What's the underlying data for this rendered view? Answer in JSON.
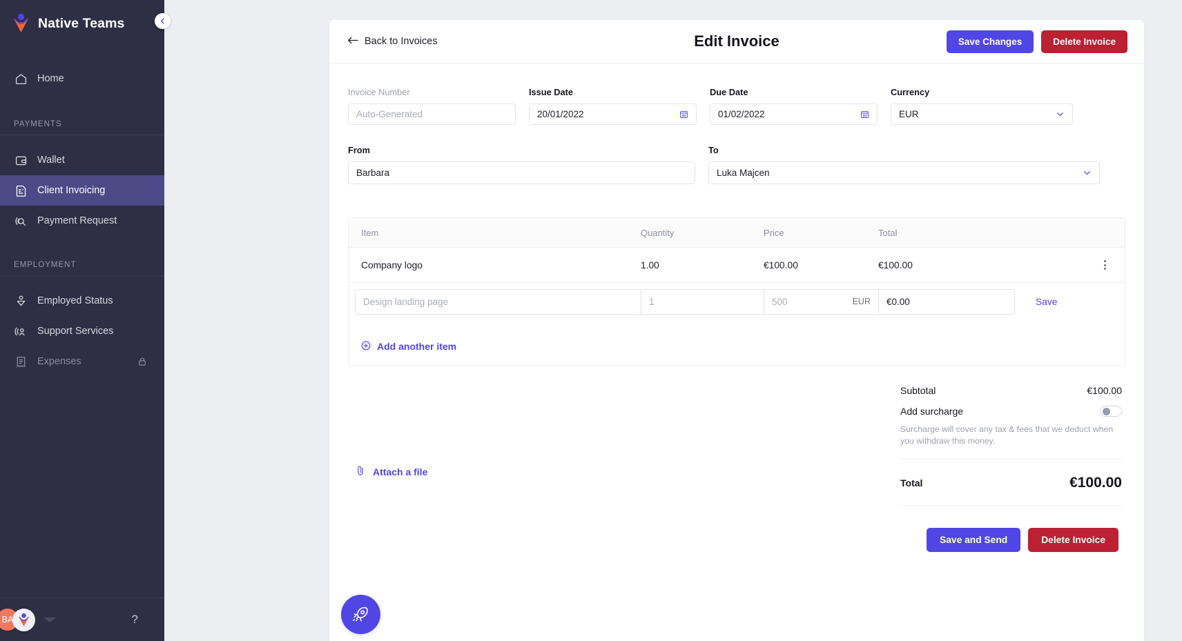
{
  "sidebar": {
    "brand": "Native Teams",
    "collapse_icon": "chevron-left-icon",
    "items_top": [
      {
        "label": "Home",
        "icon": "home-icon",
        "active": false,
        "locked": false
      }
    ],
    "sections": [
      {
        "title": "PAYMENTS",
        "items": [
          {
            "label": "Wallet",
            "icon": "wallet-icon",
            "active": false,
            "locked": false
          },
          {
            "label": "Client Invoicing",
            "icon": "invoice-icon",
            "active": true,
            "locked": false
          },
          {
            "label": "Payment Request",
            "icon": "payment-request-icon",
            "active": false,
            "locked": false
          }
        ]
      },
      {
        "title": "EMPLOYMENT",
        "items": [
          {
            "label": "Employed Status",
            "icon": "employed-status-icon",
            "active": false,
            "locked": false
          },
          {
            "label": "Support Services",
            "icon": "support-services-icon",
            "active": false,
            "locked": false
          },
          {
            "label": "Expenses",
            "icon": "expenses-icon",
            "active": false,
            "locked": true
          }
        ]
      }
    ],
    "footer": {
      "avatar_initials": "BA",
      "help_label": "?"
    },
    "fab_icon": "rocket-icon"
  },
  "header": {
    "back_label": "Back to Invoices",
    "back_icon": "arrow-left-icon",
    "title": "Edit Invoice",
    "save_changes_label": "Save Changes",
    "delete_invoice_label": "Delete Invoice"
  },
  "form": {
    "invoice_number": {
      "label": "Invoice Number",
      "value": "",
      "placeholder": "Auto-Generated"
    },
    "issue_date": {
      "label": "Issue Date",
      "value": "20/01/2022",
      "icon": "calendar-icon"
    },
    "due_date": {
      "label": "Due Date",
      "value": "01/02/2022",
      "icon": "calendar-icon"
    },
    "currency": {
      "label": "Currency",
      "value": "EUR",
      "icon": "chevron-down-icon"
    },
    "from": {
      "label": "From",
      "value": "Barbara"
    },
    "to": {
      "label": "To",
      "value": "Luka Majcen",
      "icon": "chevron-down-icon"
    }
  },
  "items_table": {
    "columns": [
      "Item",
      "Quantity",
      "Price",
      "Total"
    ],
    "rows": [
      {
        "item": "Company logo",
        "quantity": "1.00",
        "price": "€100.00",
        "total": "€100.00",
        "menu_icon": "kebab-menu-icon"
      }
    ],
    "edit_row": {
      "item_placeholder": "Design landing page",
      "quantity_placeholder": "1",
      "price_placeholder": "500",
      "price_currency": "EUR",
      "total_value": "€0.00",
      "save_label": "Save"
    },
    "add_item_label": "Add another item",
    "add_item_icon": "plus-circle-icon"
  },
  "attachment": {
    "label": "Attach a file",
    "icon": "paperclip-icon"
  },
  "totals": {
    "subtotal_label": "Subtotal",
    "subtotal_value": "€100.00",
    "surcharge_label": "Add surcharge",
    "surcharge_enabled": false,
    "surcharge_note": "Surcharge will cover any tax & fees that we deduct when you withdraw this money.",
    "total_label": "Total",
    "total_value": "€100.00"
  },
  "bottom_actions": {
    "save_and_send_label": "Save and Send",
    "delete_invoice_label": "Delete Invoice"
  },
  "colors": {
    "accent": "#4f46e5",
    "danger": "#bc2033",
    "sidebar_bg": "#2e2e44",
    "sidebar_active": "#4b4a86",
    "avatar": "#f4775f"
  }
}
